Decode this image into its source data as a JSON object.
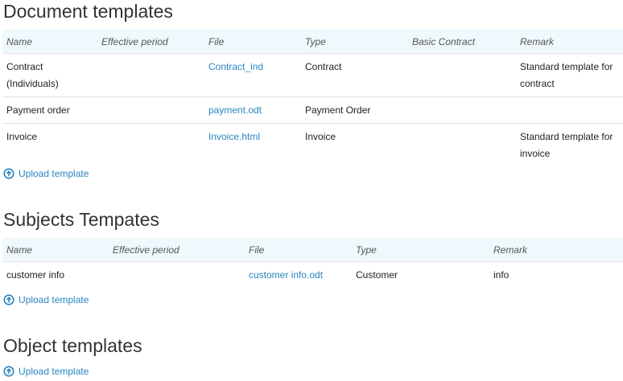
{
  "doc": {
    "title": "Document templates",
    "headers": [
      "Name",
      "Effective period",
      "File",
      "Type",
      "Basic Contract",
      "Remark"
    ],
    "rows": [
      {
        "name": "Contract (Individuals)",
        "period": "",
        "file": "Contract_ind",
        "type": "Contract",
        "basic": "",
        "remark": "Standard template for contract"
      },
      {
        "name": "Payment order",
        "period": "",
        "file": "payment.odt",
        "type": "Payment Order",
        "basic": "",
        "remark": ""
      },
      {
        "name": "Invoice",
        "period": "",
        "file": "Invoice.html",
        "type": "Invoice",
        "basic": "",
        "remark": "Standard template for invoice"
      }
    ],
    "upload_label": "Upload template"
  },
  "subj": {
    "title": "Subjects Tempates",
    "headers": [
      "Name",
      "Effective period",
      "File",
      "Type",
      "Remark"
    ],
    "rows": [
      {
        "name": "customer info",
        "period": "",
        "file": "customer info.odt",
        "type": "Customer",
        "remark": "info"
      }
    ],
    "upload_label": "Upload template"
  },
  "obj": {
    "title": "Object templates",
    "upload_label": "Upload template"
  },
  "colors": {
    "link": "#2a86c0",
    "header_bg": "#eef8fd"
  },
  "icons": {
    "upload": "circle-up-arrow-icon"
  }
}
